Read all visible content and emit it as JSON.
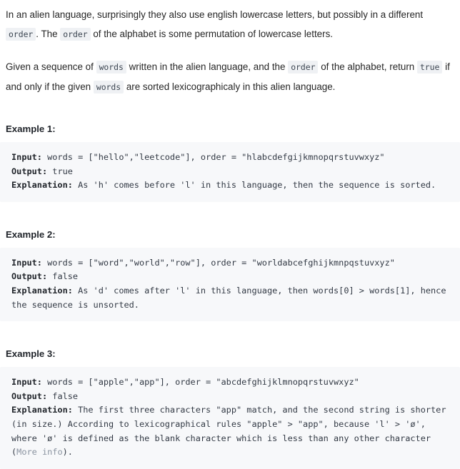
{
  "problem": {
    "intro_paragraphs": [
      {
        "id": "p1",
        "segments": [
          {
            "type": "text",
            "value": "In an alien language, surprisingly they also use english lowercase letters, but possibly in a different "
          },
          {
            "type": "code",
            "value": "order"
          },
          {
            "type": "text",
            "value": ". The "
          },
          {
            "type": "code",
            "value": "order"
          },
          {
            "type": "text",
            "value": " of the alphabet is some permutation of lowercase letters."
          }
        ]
      },
      {
        "id": "p2",
        "segments": [
          {
            "type": "text",
            "value": "Given a sequence of "
          },
          {
            "type": "code",
            "value": "words"
          },
          {
            "type": "text",
            "value": " written in the alien language, and the "
          },
          {
            "type": "code",
            "value": "order"
          },
          {
            "type": "text",
            "value": " of the alphabet, return "
          },
          {
            "type": "code",
            "value": "true"
          },
          {
            "type": "text",
            "value": " if and only if the given "
          },
          {
            "type": "code",
            "value": "words"
          },
          {
            "type": "text",
            "value": " are sorted lexicographicaly in this alien language."
          }
        ]
      }
    ],
    "examples": [
      {
        "title": "Example 1:",
        "input_label": "Input:",
        "input_value": " words = [\"hello\",\"leetcode\"], order = \"hlabcdefgijkmnopqrstuvwxyz\"",
        "output_label": "Output:",
        "output_value": " true",
        "explanation_label": "Explanation:",
        "explanation_value": " As 'h' comes before 'l' in this language, then the sequence is sorted."
      },
      {
        "title": "Example 2:",
        "input_label": "Input:",
        "input_value": " words = [\"word\",\"world\",\"row\"], order = \"worldabcefghijkmnpqstuvxyz\"",
        "output_label": "Output:",
        "output_value": " false",
        "explanation_label": "Explanation:",
        "explanation_value": " As 'd' comes after 'l' in this language, then words[0] > words[1], hence the sequence is unsorted."
      },
      {
        "title": "Example 3:",
        "input_label": "Input:",
        "input_value": " words = [\"apple\",\"app\"], order = \"abcdefghijklmnopqrstuvwxyz\"",
        "output_label": "Output:",
        "output_value": " false",
        "explanation_label": "Explanation:",
        "explanation_part1": " The first three characters \"app\" match, and the second string is shorter (in size.) According to lexicographical rules \"apple\" > \"app\", because 'l' > 'ø', where 'ø' is defined as the blank character which is less than any other character (",
        "explanation_link": "More info",
        "explanation_part2": ")."
      }
    ]
  },
  "colors": {
    "page_background": "#ffffff",
    "body_text": "#262626",
    "code_block_background": "#f7f8fa",
    "inline_code_background": "#eff1f4",
    "inline_code_text": "#3d4652",
    "link_muted": "#8a93a0",
    "heading_text": "#1f2329"
  }
}
